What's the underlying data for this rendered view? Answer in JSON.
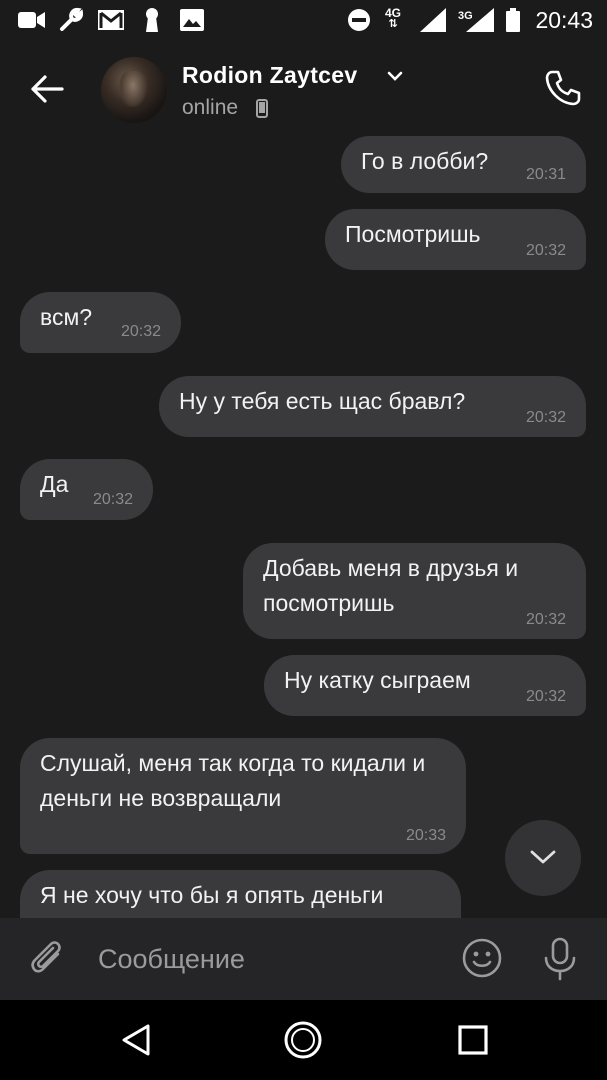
{
  "status_bar": {
    "time": "20:43",
    "network_1": "4G",
    "network_2": "3G",
    "icons": [
      "video-call-icon",
      "wrench-icon",
      "gmail-icon",
      "keyhole-icon",
      "gallery-icon",
      "do-not-disturb-icon",
      "signal-icon",
      "signal-icon",
      "battery-icon"
    ]
  },
  "header": {
    "contact_name": "Rodion Zaytcev",
    "status": "online"
  },
  "messages": [
    {
      "dir": "out",
      "text": "Го в лобби?",
      "time": "20:31"
    },
    {
      "dir": "out",
      "text": "Посмотришь",
      "time": "20:32"
    },
    {
      "dir": "in",
      "text": "всм?",
      "time": "20:32"
    },
    {
      "dir": "out",
      "text": "Ну у тебя есть щас бравл?",
      "time": "20:32"
    },
    {
      "dir": "in",
      "text": "Да",
      "time": "20:32"
    },
    {
      "dir": "out",
      "text": "Добавь меня в друзья и посмотришь",
      "time": "20:32"
    },
    {
      "dir": "out",
      "text": "Ну катку сыграем",
      "time": "20:32"
    },
    {
      "dir": "in",
      "text": "Слушай, меня так когда то кидали и деньги не возвращали",
      "time": "20:33"
    },
    {
      "dir": "in",
      "text": "Я не хочу что бы я опять деньги",
      "time": ""
    }
  ],
  "composer": {
    "placeholder": "Сообщение"
  },
  "colors": {
    "background": "#1b1b1c",
    "bubble": "#3a3a3c",
    "composer": "#252527",
    "navbar": "#000000"
  }
}
